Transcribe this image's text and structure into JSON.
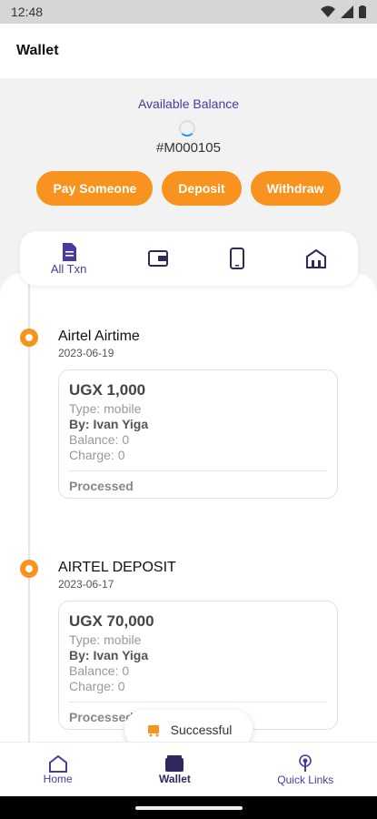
{
  "status_bar": {
    "time": "12:48"
  },
  "app_bar": {
    "title": "Wallet"
  },
  "balance": {
    "label": "Available Balance",
    "account_id": "#M000105"
  },
  "actions": {
    "pay_label": "Pay Someone",
    "deposit_label": "Deposit",
    "withdraw_label": "Withdraw"
  },
  "tabs": [
    {
      "label": "All Txn",
      "icon": "document-icon"
    },
    {
      "label": "",
      "icon": "wallet-icon"
    },
    {
      "label": "",
      "icon": "phone-icon"
    },
    {
      "label": "",
      "icon": "bank-icon"
    }
  ],
  "transactions": [
    {
      "title": "Airtel Airtime",
      "date": "2023-06-19",
      "amount": "UGX 1,000",
      "type": "Type: mobile",
      "by": "By: Ivan Yiga",
      "balance": "Balance: 0",
      "charge": "Charge: 0",
      "status": "Processed"
    },
    {
      "title": "AIRTEL DEPOSIT",
      "date": "2023-06-17",
      "amount": "UGX 70,000",
      "type": "Type: mobile",
      "by": "By: Ivan Yiga",
      "balance": "Balance: 0",
      "charge": "Charge: 0",
      "status": "Processed"
    }
  ],
  "toast": {
    "message": "Successful"
  },
  "bottom_nav": {
    "home": "Home",
    "wallet": "Wallet",
    "quick_links": "Quick Links"
  },
  "colors": {
    "accent": "#f7931e",
    "primary": "#4a3aa0"
  }
}
